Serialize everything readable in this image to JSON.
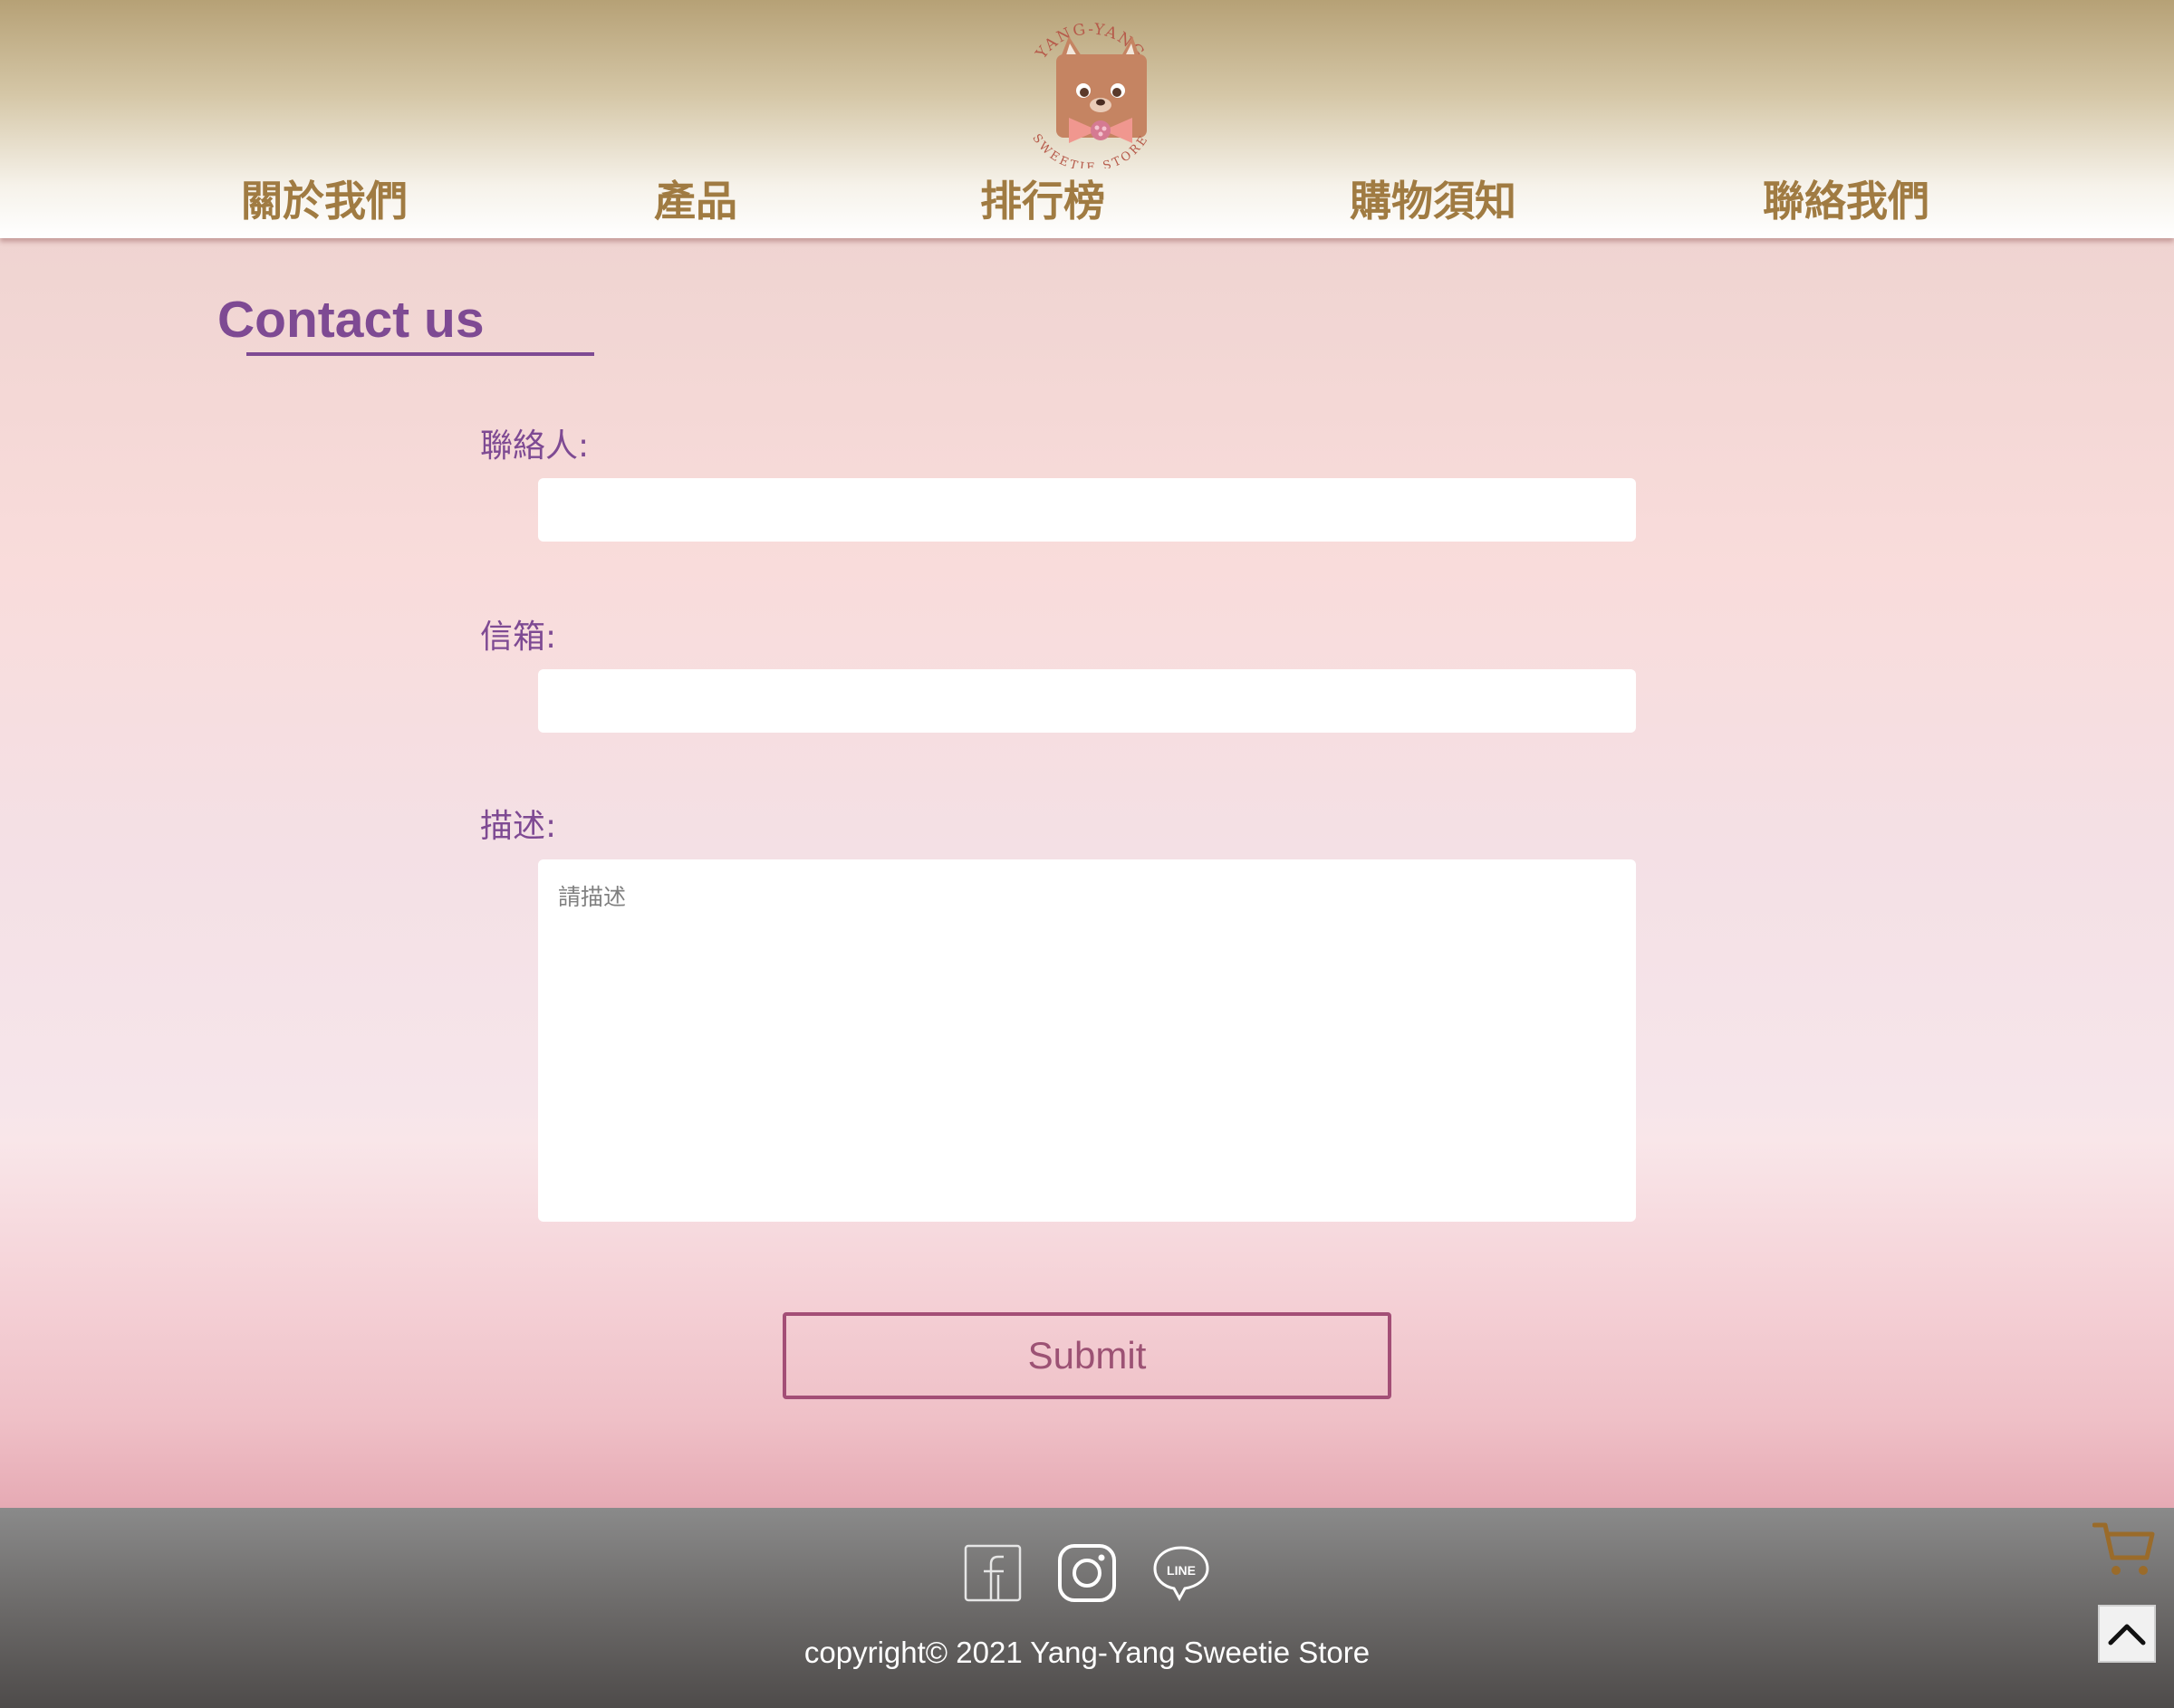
{
  "brand": {
    "logo_top_text": "YANG-YANG",
    "logo_bottom_text": "SWEETIE STORE"
  },
  "nav": {
    "items": [
      {
        "label": "關於我們"
      },
      {
        "label": "產品"
      },
      {
        "label": "排行榜"
      },
      {
        "label": "購物須知"
      },
      {
        "label": "聯絡我們"
      }
    ]
  },
  "contact": {
    "title": "Contact us",
    "name_label": "聯絡人:",
    "name_value": "",
    "email_label": "信箱:",
    "email_value": "",
    "desc_label": "描述:",
    "desc_placeholder": "請描述",
    "submit_label": "Submit"
  },
  "footer": {
    "social": [
      {
        "icon": "facebook-icon"
      },
      {
        "icon": "instagram-icon"
      },
      {
        "icon": "line-icon",
        "text": "LINE"
      }
    ],
    "copyright": "copyright© 2021 Yang-Yang Sweetie Store"
  },
  "floating": {
    "cart_icon": "cart-icon",
    "top_icon": "chevron-up-icon"
  },
  "colors": {
    "nav_text": "#a07b42",
    "accent_purple": "#7e4a93",
    "submit_border": "#a34e76"
  }
}
